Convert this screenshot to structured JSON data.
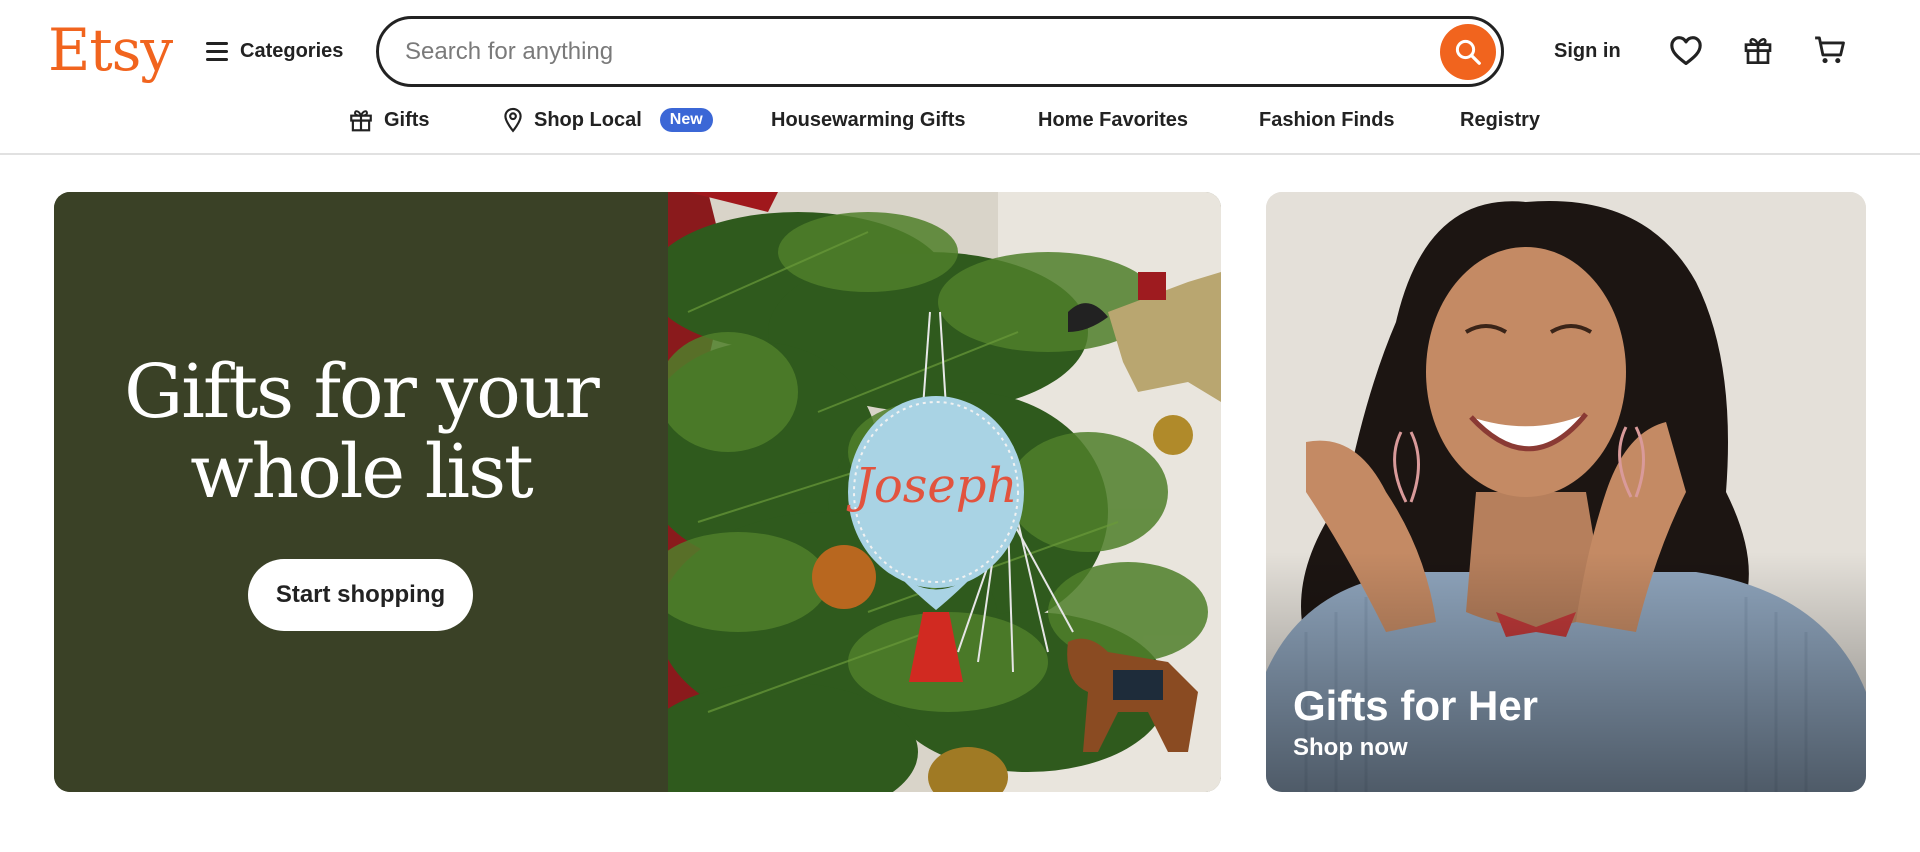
{
  "header": {
    "logo": "Etsy",
    "categories_label": "Categories",
    "search_placeholder": "Search for anything",
    "signin_label": "Sign in"
  },
  "nav": {
    "items": [
      {
        "label": "Gifts",
        "icon": "gift-icon"
      },
      {
        "label": "Shop Local",
        "icon": "location-pin-icon",
        "badge": "New"
      },
      {
        "label": "Housewarming Gifts"
      },
      {
        "label": "Home Favorites"
      },
      {
        "label": "Fashion Finds"
      },
      {
        "label": "Registry"
      }
    ]
  },
  "hero": {
    "title_line1": "Gifts for your",
    "title_line2": "whole list",
    "cta": "Start shopping",
    "ornament_text": "Joseph"
  },
  "promo": {
    "title": "Gifts for Her",
    "cta": "Shop now"
  },
  "colors": {
    "brand": "#f1641e",
    "hero_green": "#3a4126",
    "badge_blue": "#3b67d6"
  }
}
